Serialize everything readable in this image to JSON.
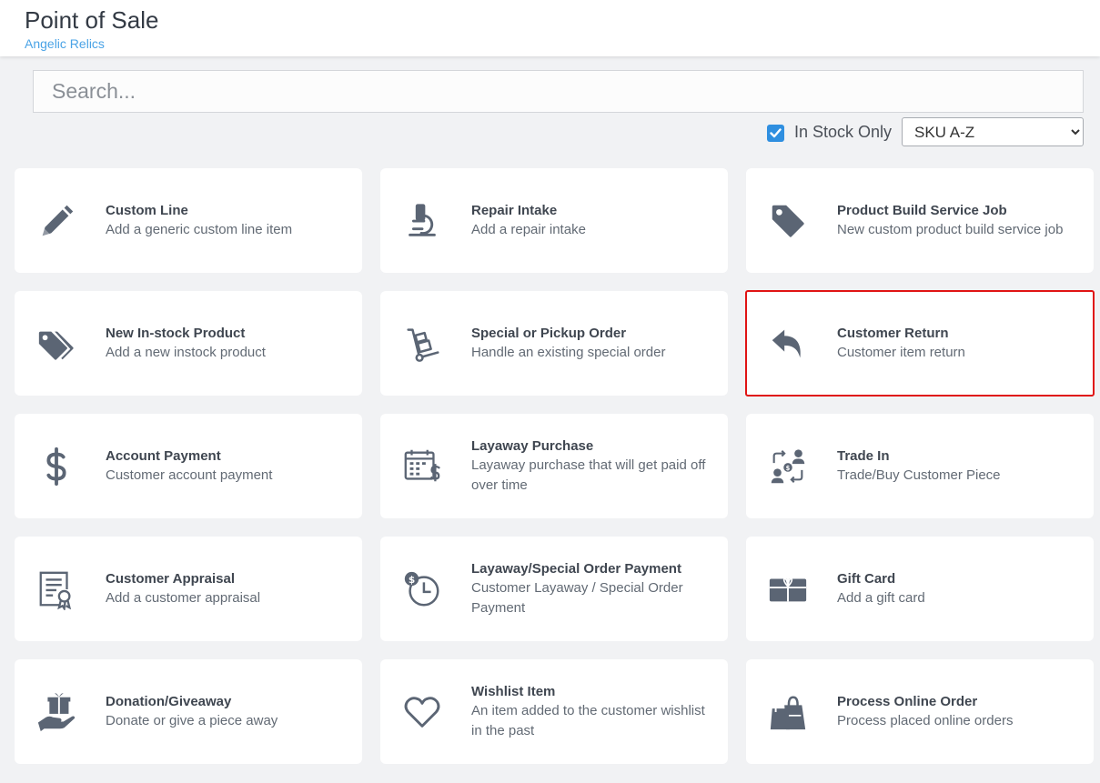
{
  "header": {
    "title": "Point of Sale",
    "subtitle": "Angelic Relics"
  },
  "search": {
    "placeholder": "Search..."
  },
  "filter": {
    "in_stock_label": "In Stock Only",
    "in_stock_checked": true,
    "sort_selected": "SKU A-Z"
  },
  "colors": {
    "accent": "#2f8fe0",
    "icon": "#5b6574",
    "selected_outline": "#e01414"
  },
  "cards": [
    {
      "name": "Custom Line",
      "desc": "Add a generic custom line item",
      "icon": "pencil-icon"
    },
    {
      "name": "Repair Intake",
      "desc": "Add a repair intake",
      "icon": "microscope-icon"
    },
    {
      "name": "Product Build Service Job",
      "desc": "New custom product build service job",
      "icon": "tag-icon"
    },
    {
      "name": "New In-stock Product",
      "desc": "Add a new instock product",
      "icon": "tags-icon"
    },
    {
      "name": "Special or Pickup Order",
      "desc": "Handle an existing special order",
      "icon": "dolly-icon"
    },
    {
      "name": "Customer Return",
      "desc": "Customer item return",
      "icon": "reply-icon",
      "selected": true
    },
    {
      "name": "Account Payment",
      "desc": "Customer account payment",
      "icon": "dollar-icon"
    },
    {
      "name": "Layaway Purchase",
      "desc": "Layaway purchase that will get paid off over time",
      "icon": "calendar-dollar-icon"
    },
    {
      "name": "Trade In",
      "desc": "Trade/Buy Customer Piece",
      "icon": "trade-icon"
    },
    {
      "name": "Customer Appraisal",
      "desc": "Add a customer appraisal",
      "icon": "certificate-icon"
    },
    {
      "name": "Layaway/Special Order Payment",
      "desc": "Customer Layaway / Special Order Payment",
      "icon": "clock-dollar-icon"
    },
    {
      "name": "Gift Card",
      "desc": "Add a gift card",
      "icon": "gift-card-icon"
    },
    {
      "name": "Donation/Giveaway",
      "desc": "Donate or give a piece away",
      "icon": "hand-gift-icon"
    },
    {
      "name": "Wishlist Item",
      "desc": "An item added to the customer wishlist in the past",
      "icon": "heart-icon"
    },
    {
      "name": "Process Online Order",
      "desc": "Process placed online orders",
      "icon": "shopping-bag-icon"
    }
  ]
}
